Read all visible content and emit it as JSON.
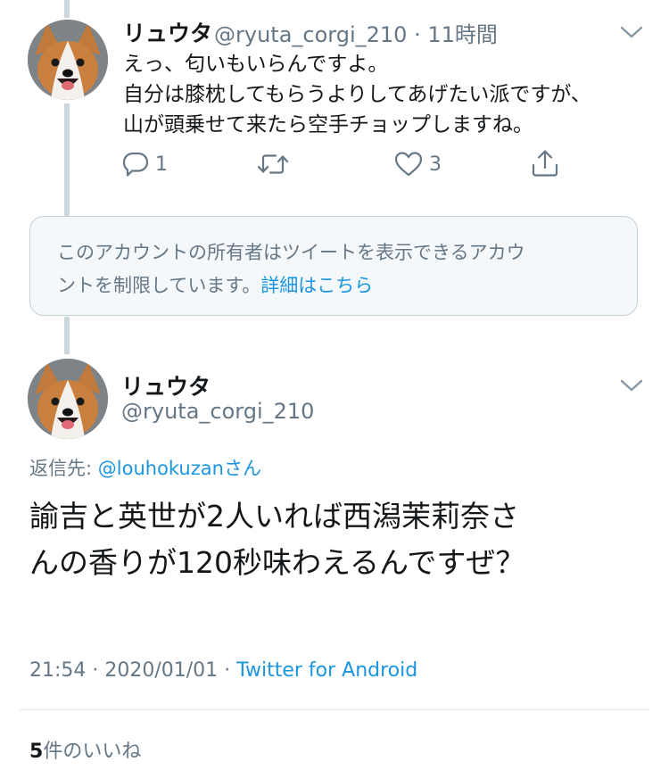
{
  "first_tweet": {
    "display_name": "リュウタ",
    "handle": "@ryuta_corgi_210",
    "separator": "·",
    "time_ago": "11時間",
    "lines": [
      "えっ、匂いもいらんですよ。",
      "自分は膝枕してもらうよりしてあげたい派ですが、",
      "山が頭乗せて来たら空手チョップしますね。"
    ],
    "actions": {
      "reply_count": "1",
      "retweet_count": "",
      "like_count": "3"
    }
  },
  "protected_notice": {
    "line1": "このアカウントの所有者はツイートを表示できるアカウ",
    "line2_prefix": "ントを制限しています。",
    "link_text": "詳細はこちら"
  },
  "main_tweet": {
    "display_name": "リュウタ",
    "handle": "@ryuta_corgi_210",
    "reply_prefix": "返信先: ",
    "reply_target": "@louhokuzan",
    "reply_suffix": "さん",
    "lines": [
      "諭吉と英世が2人いれば西潟茉莉奈さ",
      "んの香りが120秒味わえるんですぜ？"
    ],
    "timestamp": "21:54 · 2020/01/01 · ",
    "source": "Twitter for Android",
    "likes_count": "5",
    "likes_label": "件のいいね"
  },
  "colors": {
    "accent": "#1b95e0",
    "muted": "#657786",
    "text": "#14171a",
    "border": "#c4cfd6"
  }
}
